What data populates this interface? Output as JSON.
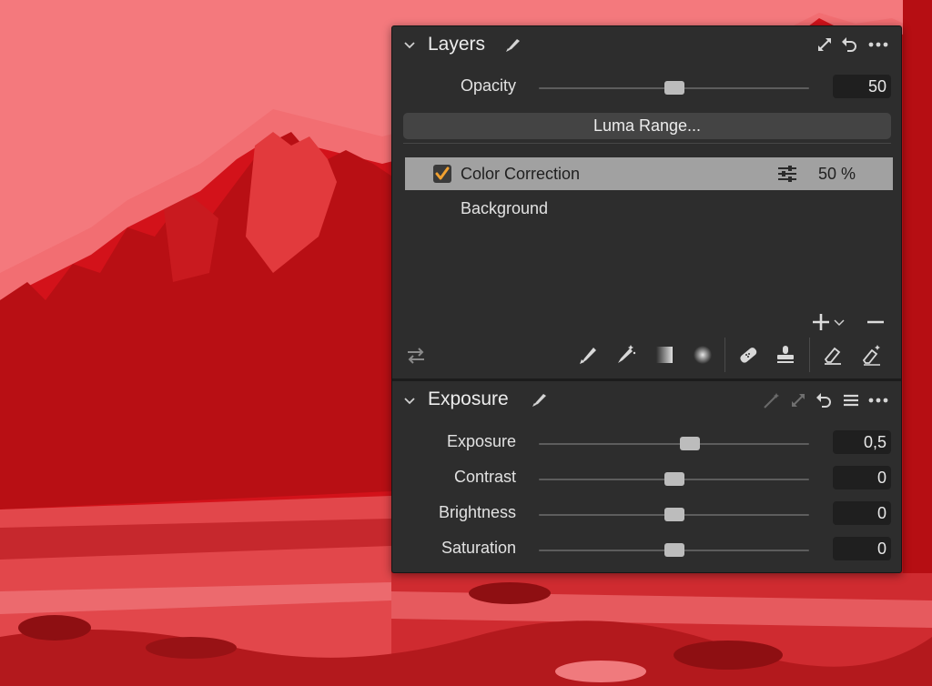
{
  "layers_panel": {
    "title": "Layers",
    "opacity_label": "Opacity",
    "opacity_value": "50",
    "opacity_fraction": 0.5,
    "luma_button": "Luma Range...",
    "layers": [
      {
        "name": "Color Correction",
        "opacity": "50 %",
        "checked": true,
        "selected": true
      },
      {
        "name": "Background",
        "opacity": "",
        "checked": false,
        "selected": false
      }
    ]
  },
  "exposure_panel": {
    "title": "Exposure",
    "sliders": [
      {
        "label": "Exposure",
        "value": "0,5",
        "fraction": 0.56
      },
      {
        "label": "Contrast",
        "value": "0",
        "fraction": 0.5
      },
      {
        "label": "Brightness",
        "value": "0",
        "fraction": 0.5
      },
      {
        "label": "Saturation",
        "value": "0",
        "fraction": 0.5
      }
    ]
  },
  "colors": {
    "panel_bg": "#2d2d2d",
    "accent_check": "#f0a030",
    "selected_row": "#a1a1a1",
    "photo_tint": "#d4141a"
  }
}
